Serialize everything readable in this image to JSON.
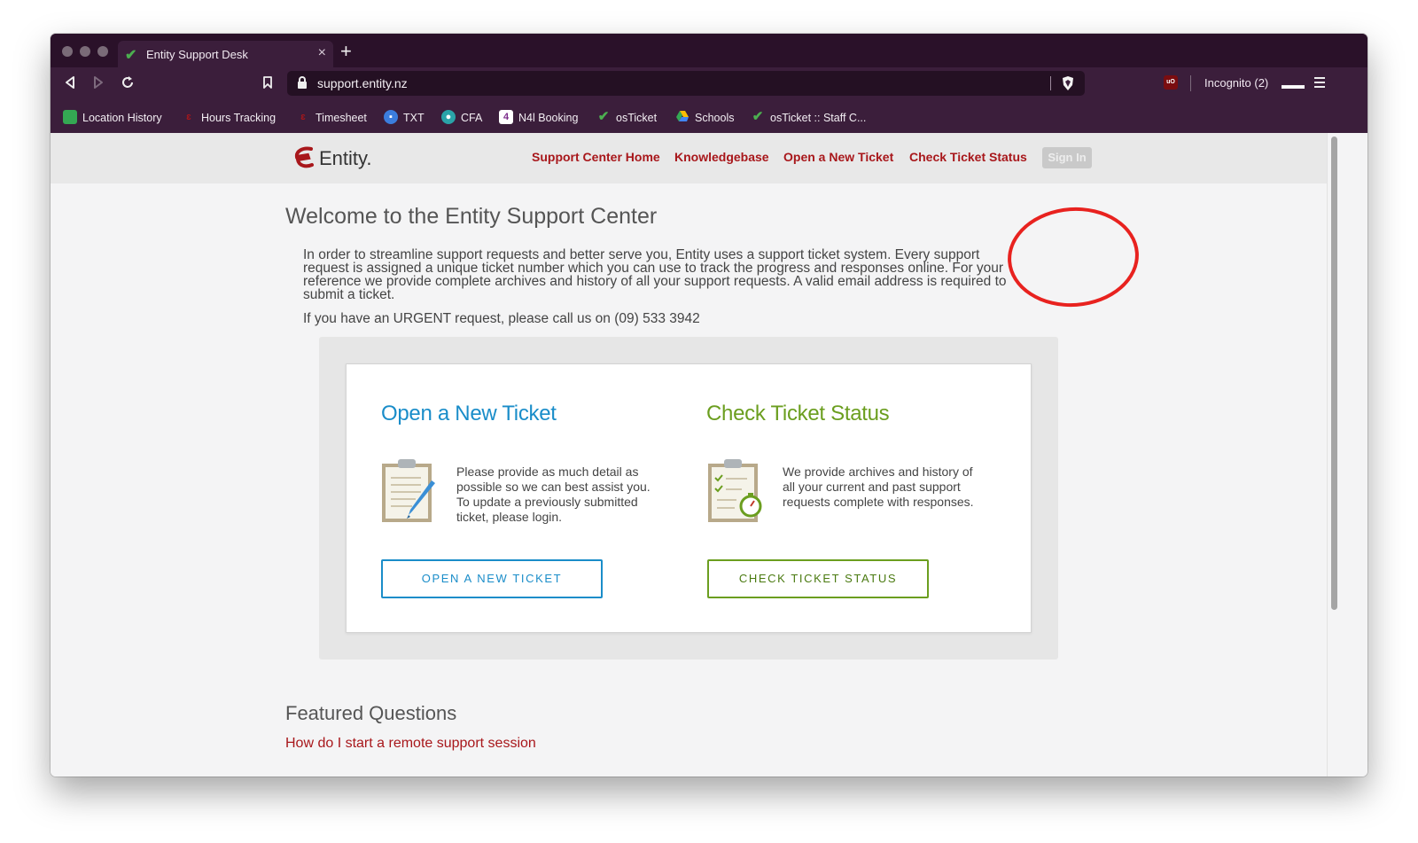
{
  "browser": {
    "tab_title": "Entity Support Desk",
    "url": "support.entity.nz",
    "incognito_label": "Incognito (2)",
    "bookmarks": [
      {
        "label": "Location History",
        "icon": "google-maps-icon",
        "color": "#4285f4"
      },
      {
        "label": "Hours Tracking",
        "icon": "entity-favicon",
        "color": "#a8171b"
      },
      {
        "label": "Timesheet",
        "icon": "entity-favicon",
        "color": "#a8171b"
      },
      {
        "label": "TXT",
        "icon": "txt-icon",
        "color": "#3b7ddd"
      },
      {
        "label": "CFA",
        "icon": "cfa-icon",
        "color": "#2aa3a8"
      },
      {
        "label": "N4l Booking",
        "icon": "n4l-icon",
        "color": "#7b2c8a"
      },
      {
        "label": "osTicket",
        "icon": "checkmark-icon",
        "color": "#4caf50"
      },
      {
        "label": "Schools",
        "icon": "google-drive-icon",
        "color": "#fbbc04"
      },
      {
        "label": "osTicket :: Staff C...",
        "icon": "checkmark-icon",
        "color": "#4caf50"
      }
    ]
  },
  "site": {
    "logo_text": "Entity.",
    "brand_color": "#a8171b",
    "nav": [
      "Support Center Home",
      "Knowledgebase",
      "Open a New Ticket",
      "Check Ticket Status"
    ],
    "sign_in": "Sign In"
  },
  "main": {
    "title": "Welcome to the Entity Support Center",
    "intro_lines": [
      "In order to streamline support requests and better serve you, Entity uses a support ticket system. Every support",
      "request is assigned a unique ticket number which you can use to track the progress and responses online. For your",
      "reference we provide complete archives and history of all your support requests. A valid email address is required to",
      "submit a ticket."
    ],
    "urgent": "If you have an URGENT request, please call us on (09) 533 3942"
  },
  "cards": {
    "open": {
      "title": "Open a New Ticket",
      "text": "Please provide as much detail as possible so we can best assist you. To update a previously submitted ticket, please login.",
      "button": "OPEN A NEW TICKET",
      "color": "#1a8dc9"
    },
    "check": {
      "title": "Check Ticket Status",
      "text": "We provide archives and history of all your current and past support requests complete with responses.",
      "button": "CHECK TICKET STATUS",
      "color": "#6b9e1f"
    }
  },
  "featured": {
    "title": "Featured Questions",
    "items": [
      "How do I start a remote support session"
    ]
  },
  "annotation": {
    "circle_color": "#e8221f"
  }
}
